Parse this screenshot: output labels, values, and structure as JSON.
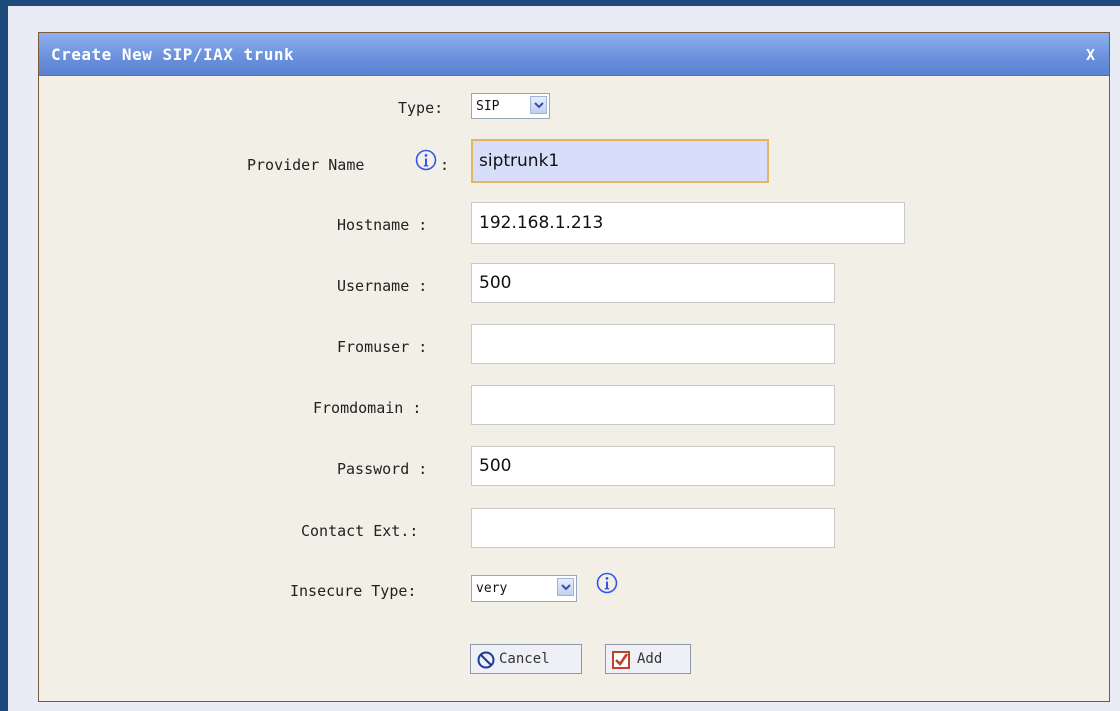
{
  "dialog": {
    "title": "Create New SIP/IAX trunk",
    "close_label": "X"
  },
  "form": {
    "type": {
      "label": "Type:",
      "selected": "SIP"
    },
    "provider_name": {
      "label": "Provider Name",
      "suffix": ":",
      "value": "siptrunk1"
    },
    "hostname": {
      "label": "Hostname :",
      "value": "192.168.1.213"
    },
    "username": {
      "label": "Username :",
      "value": "500"
    },
    "fromuser": {
      "label": "Fromuser :",
      "value": ""
    },
    "fromdomain": {
      "label": "Fromdomain :",
      "value": ""
    },
    "password": {
      "label": "Password :",
      "value": "500"
    },
    "contact_ext": {
      "label": "Contact Ext.:",
      "value": ""
    },
    "insecure_type": {
      "label": "Insecure Type:",
      "selected": "very"
    }
  },
  "buttons": {
    "cancel_label": "Cancel",
    "add_label": "Add"
  },
  "colors": {
    "titlebar": "#6c92dd",
    "dialog_bg": "#f2efe6",
    "info_icon": "#3355ee",
    "focus_border": "#e6b560"
  },
  "icons": {
    "info": "info-icon",
    "cancel": "cancel-circle-icon",
    "add": "checkbox-checked-icon",
    "dropdown": "chevron-down-icon"
  }
}
